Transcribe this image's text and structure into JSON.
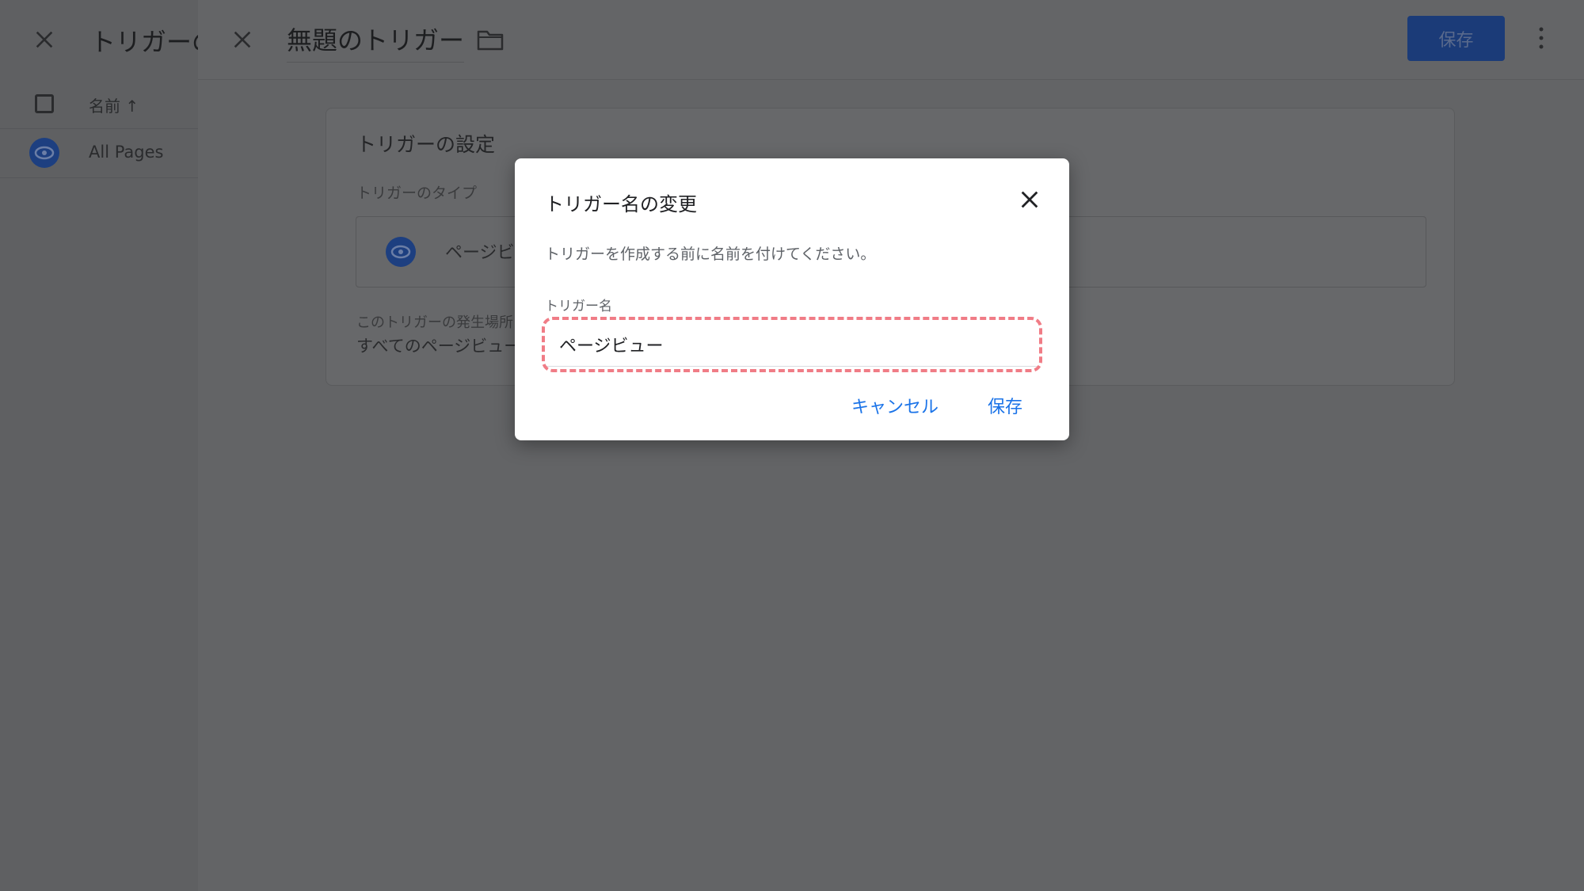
{
  "left_panel": {
    "header_title": "トリガーの",
    "column_header": "名前 ↑",
    "rows": [
      {
        "label": "All Pages",
        "icon": "eye-icon"
      }
    ]
  },
  "editor": {
    "title": "無題のトリガー",
    "save_label": "保存",
    "card": {
      "title": "トリガーの設定",
      "type_label": "トリガーのタイプ",
      "type_value": "ページビ",
      "fires_label": "このトリガーの発生場所",
      "fires_value": "すべてのページビュー"
    }
  },
  "dialog": {
    "title": "トリガー名の変更",
    "description": "トリガーを作成する前に名前を付けてください。",
    "field_label": "トリガー名",
    "field_value": "ページビュー",
    "cancel_label": "キャンセル",
    "save_label": "保存"
  },
  "colors": {
    "accent": "#1a73e8",
    "highlight": "#f07c86",
    "overlay": "#626365"
  }
}
